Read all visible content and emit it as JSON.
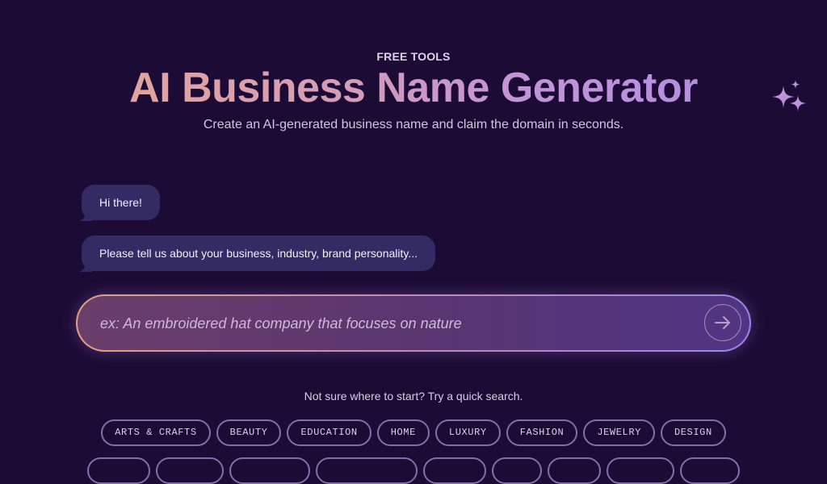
{
  "header": {
    "eyebrow": "FREE TOOLS",
    "title": "AI Business Name Generator",
    "subtitle": "Create an AI-generated business name and claim the domain in seconds."
  },
  "chat": {
    "messages": [
      "Hi there!",
      "Please tell us about your business, industry, brand personality..."
    ]
  },
  "prompt": {
    "value": "",
    "placeholder": "ex: An embroidered hat company that focuses on nature",
    "submit_icon": "arrow-right-icon"
  },
  "quick_search": {
    "helper": "Not sure where to start? Try a quick search.",
    "chips": [
      "ARTS & CRAFTS",
      "BEAUTY",
      "EDUCATION",
      "HOME",
      "LUXURY",
      "FASHION",
      "JEWELRY",
      "DESIGN"
    ]
  },
  "colors": {
    "background": "#1c0c35",
    "bubble": "#352b64",
    "title_gradient_start": "#e7a98e",
    "title_gradient_end": "#a98be6",
    "chip_border": "#7d72a8"
  },
  "icons": {
    "decoration": "sparkles-icon"
  }
}
